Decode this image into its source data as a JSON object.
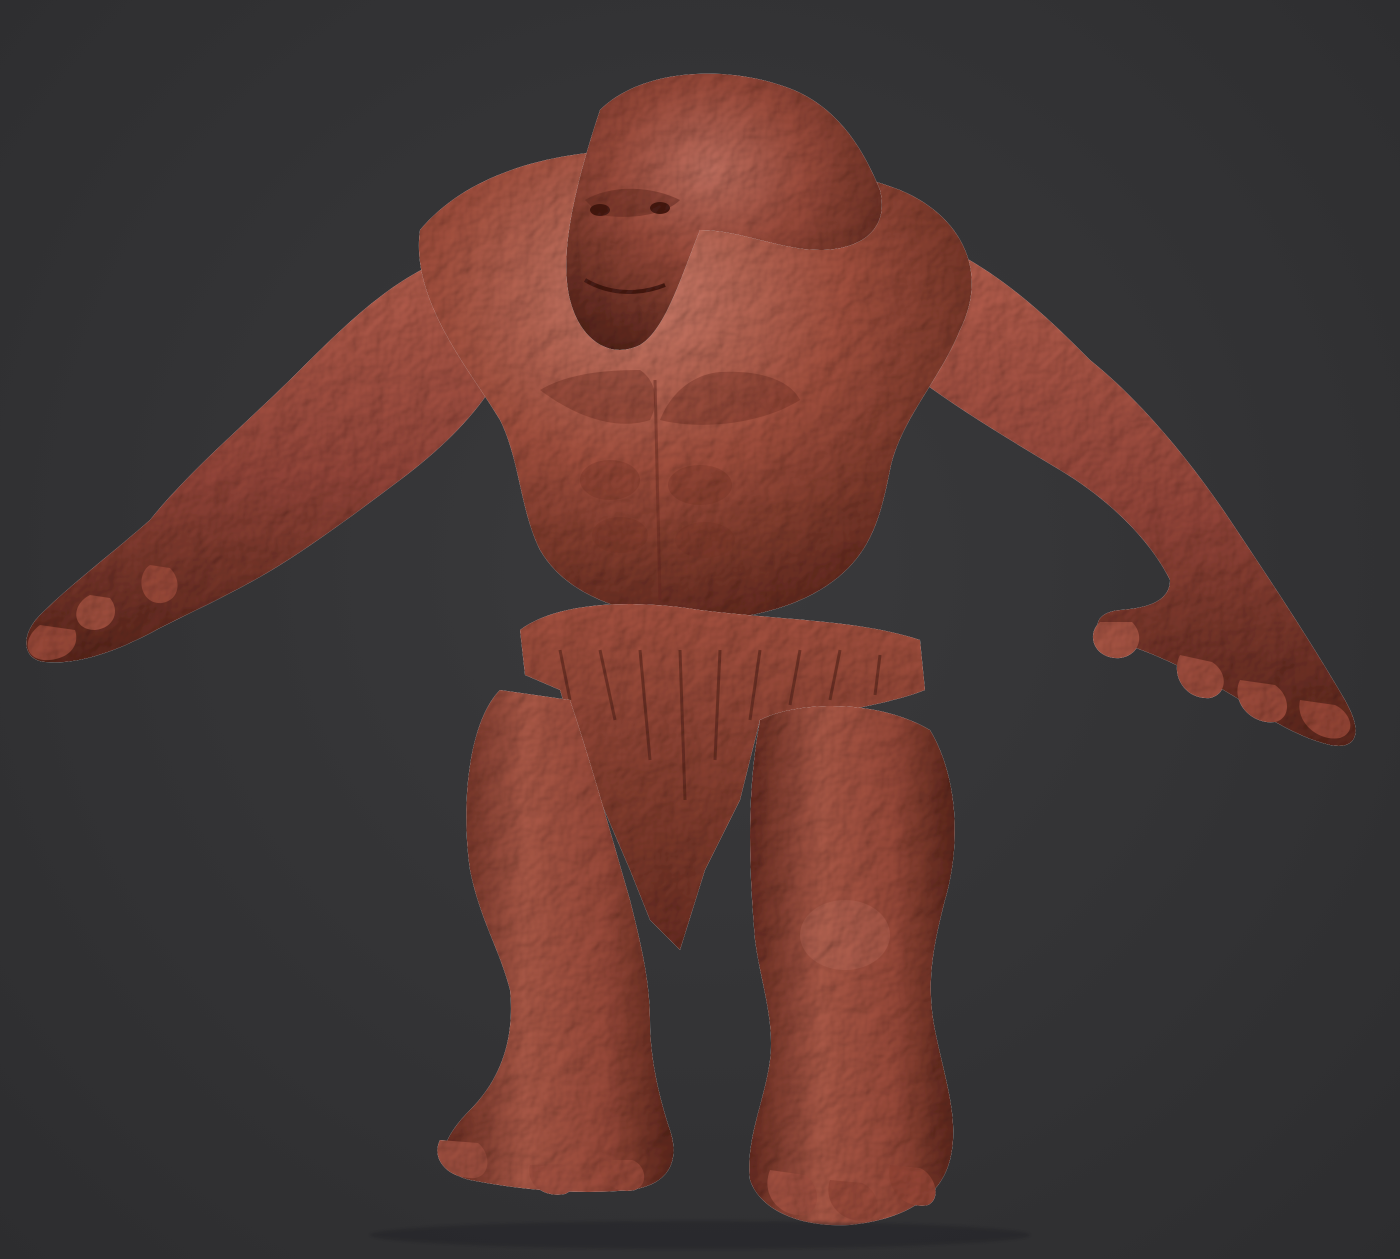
{
  "scene": {
    "background_color": "#323234",
    "material_color": "#9a4a3a",
    "material_highlight": "#c7735f",
    "material_shadow": "#4e2018",
    "subject": "clay-sculpt-creature"
  }
}
